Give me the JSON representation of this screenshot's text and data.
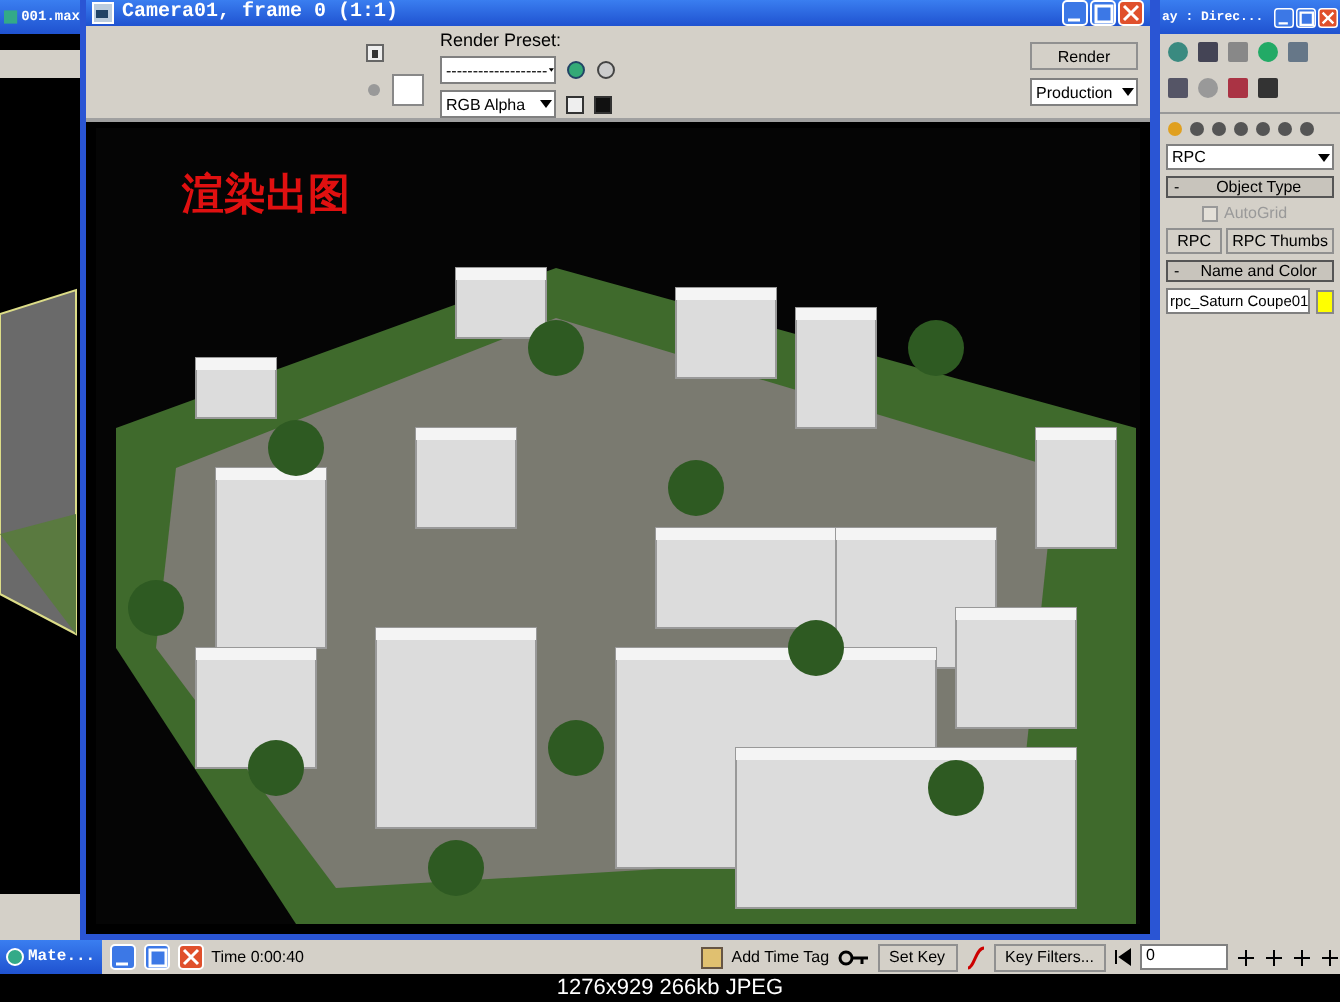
{
  "background_window": {
    "title": "001.max",
    "title_right": "ay : Direc..."
  },
  "render_window": {
    "title": "Camera01, frame 0 (1:1)",
    "preset_label": "Render Preset:",
    "preset_value": "-------------------",
    "render_button": "Render",
    "mode": "Production",
    "channel": "RGB Alpha",
    "annotation": "渲染出图"
  },
  "command_panel": {
    "category": "RPC",
    "rollouts": [
      {
        "sign": "-",
        "title": "Object Type"
      },
      {
        "sign": "-",
        "title": "Name and Color"
      }
    ],
    "autogrid": {
      "label": "AutoGrid",
      "checked": false,
      "disabled": true
    },
    "buttons": [
      "RPC",
      "RPC Thumbs"
    ],
    "name_field": "rpc_Saturn Coupe01",
    "color": "#ffff00"
  },
  "status_bar": {
    "taskbar_item": "Mate...",
    "time": "Time 0:00:40",
    "add_time_tag": "Add Time Tag",
    "set_key": "Set Key",
    "key_filters": "Key Filters...",
    "frame": "0"
  },
  "image_info": "1276x929 266kb JPEG"
}
